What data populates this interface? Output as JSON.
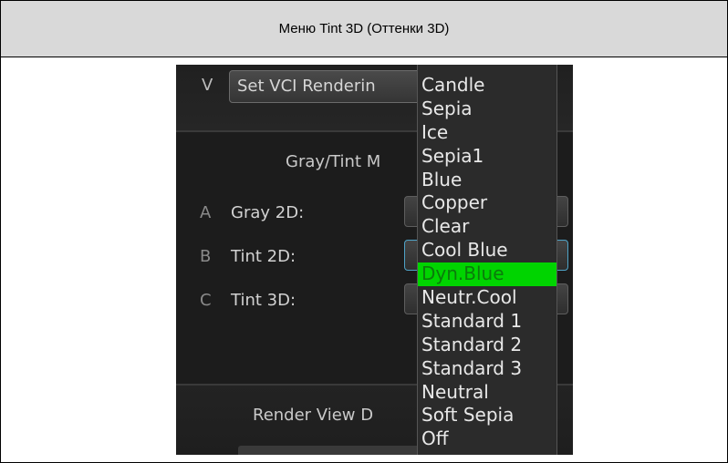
{
  "header": {
    "title": "Меню Tint 3D (Оттенки 3D)"
  },
  "screenshot": {
    "top_row": {
      "key": "V",
      "button_label": "Set VCI Renderin"
    },
    "gray_tint_section": {
      "title": "Gray/Tint M",
      "rows": [
        {
          "key": "A",
          "label": "Gray 2D:"
        },
        {
          "key": "B",
          "label": "Tint 2D:"
        },
        {
          "key": "C",
          "label": "Tint 3D:"
        }
      ]
    },
    "render_view_section": {
      "title": "Render View D"
    },
    "dropdown": {
      "selected": "Dyn.Blue",
      "selected_color": "#00d400",
      "options": [
        "Candle",
        "Sepia",
        "Ice",
        "Sepia1",
        "Blue",
        "Copper",
        "Clear",
        "Cool Blue",
        "Dyn.Blue",
        "Neutr.Cool",
        "Standard 1",
        "Standard 2",
        "Standard 3",
        "Neutral",
        "Soft Sepia",
        "Off"
      ]
    }
  }
}
